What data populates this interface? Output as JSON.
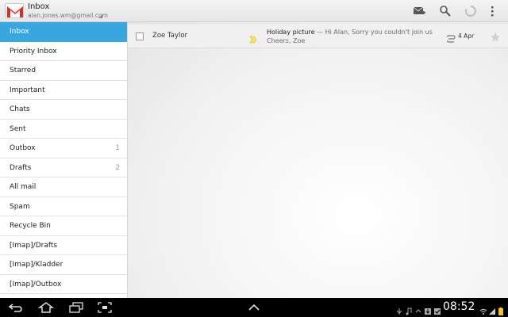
{
  "header": {
    "title": "Inbox",
    "account": "alan.jones.wm@gmail.com"
  },
  "sidebar": {
    "items": [
      {
        "label": "Inbox",
        "count": "",
        "active": true
      },
      {
        "label": "Priority Inbox",
        "count": ""
      },
      {
        "label": "Starred",
        "count": ""
      },
      {
        "label": "Important",
        "count": ""
      },
      {
        "label": "Chats",
        "count": ""
      },
      {
        "label": "Sent",
        "count": ""
      },
      {
        "label": "Outbox",
        "count": "1"
      },
      {
        "label": "Drafts",
        "count": "2"
      },
      {
        "label": "All mail",
        "count": ""
      },
      {
        "label": "Spam",
        "count": ""
      },
      {
        "label": "Recycle Bin",
        "count": ""
      },
      {
        "label": "[Imap]/Drafts",
        "count": ""
      },
      {
        "label": "[Imap]/Kladder",
        "count": ""
      },
      {
        "label": "[Imap]/Outbox",
        "count": ""
      }
    ]
  },
  "messages": [
    {
      "sender": "Zoe Taylor",
      "subject": "Holiday picture",
      "snippet": " — Hi Alan, Sorry you couldn't join us",
      "snippet2": "Cheers, Zoe",
      "date": "4 Apr"
    }
  ],
  "statusbar": {
    "time": "08:52"
  },
  "icons": {
    "compose": "compose-icon",
    "search": "search-icon",
    "refresh": "refresh-icon",
    "overflow": "overflow-menu-icon",
    "back": "back-icon",
    "home": "home-icon",
    "recent": "recent-apps-icon",
    "screenshot": "screenshot-icon",
    "up": "chevron-up-icon"
  },
  "colors": {
    "accent": "#3aa6e0",
    "label_marker": "#f2d73a",
    "gmail_red": "#d93025"
  }
}
